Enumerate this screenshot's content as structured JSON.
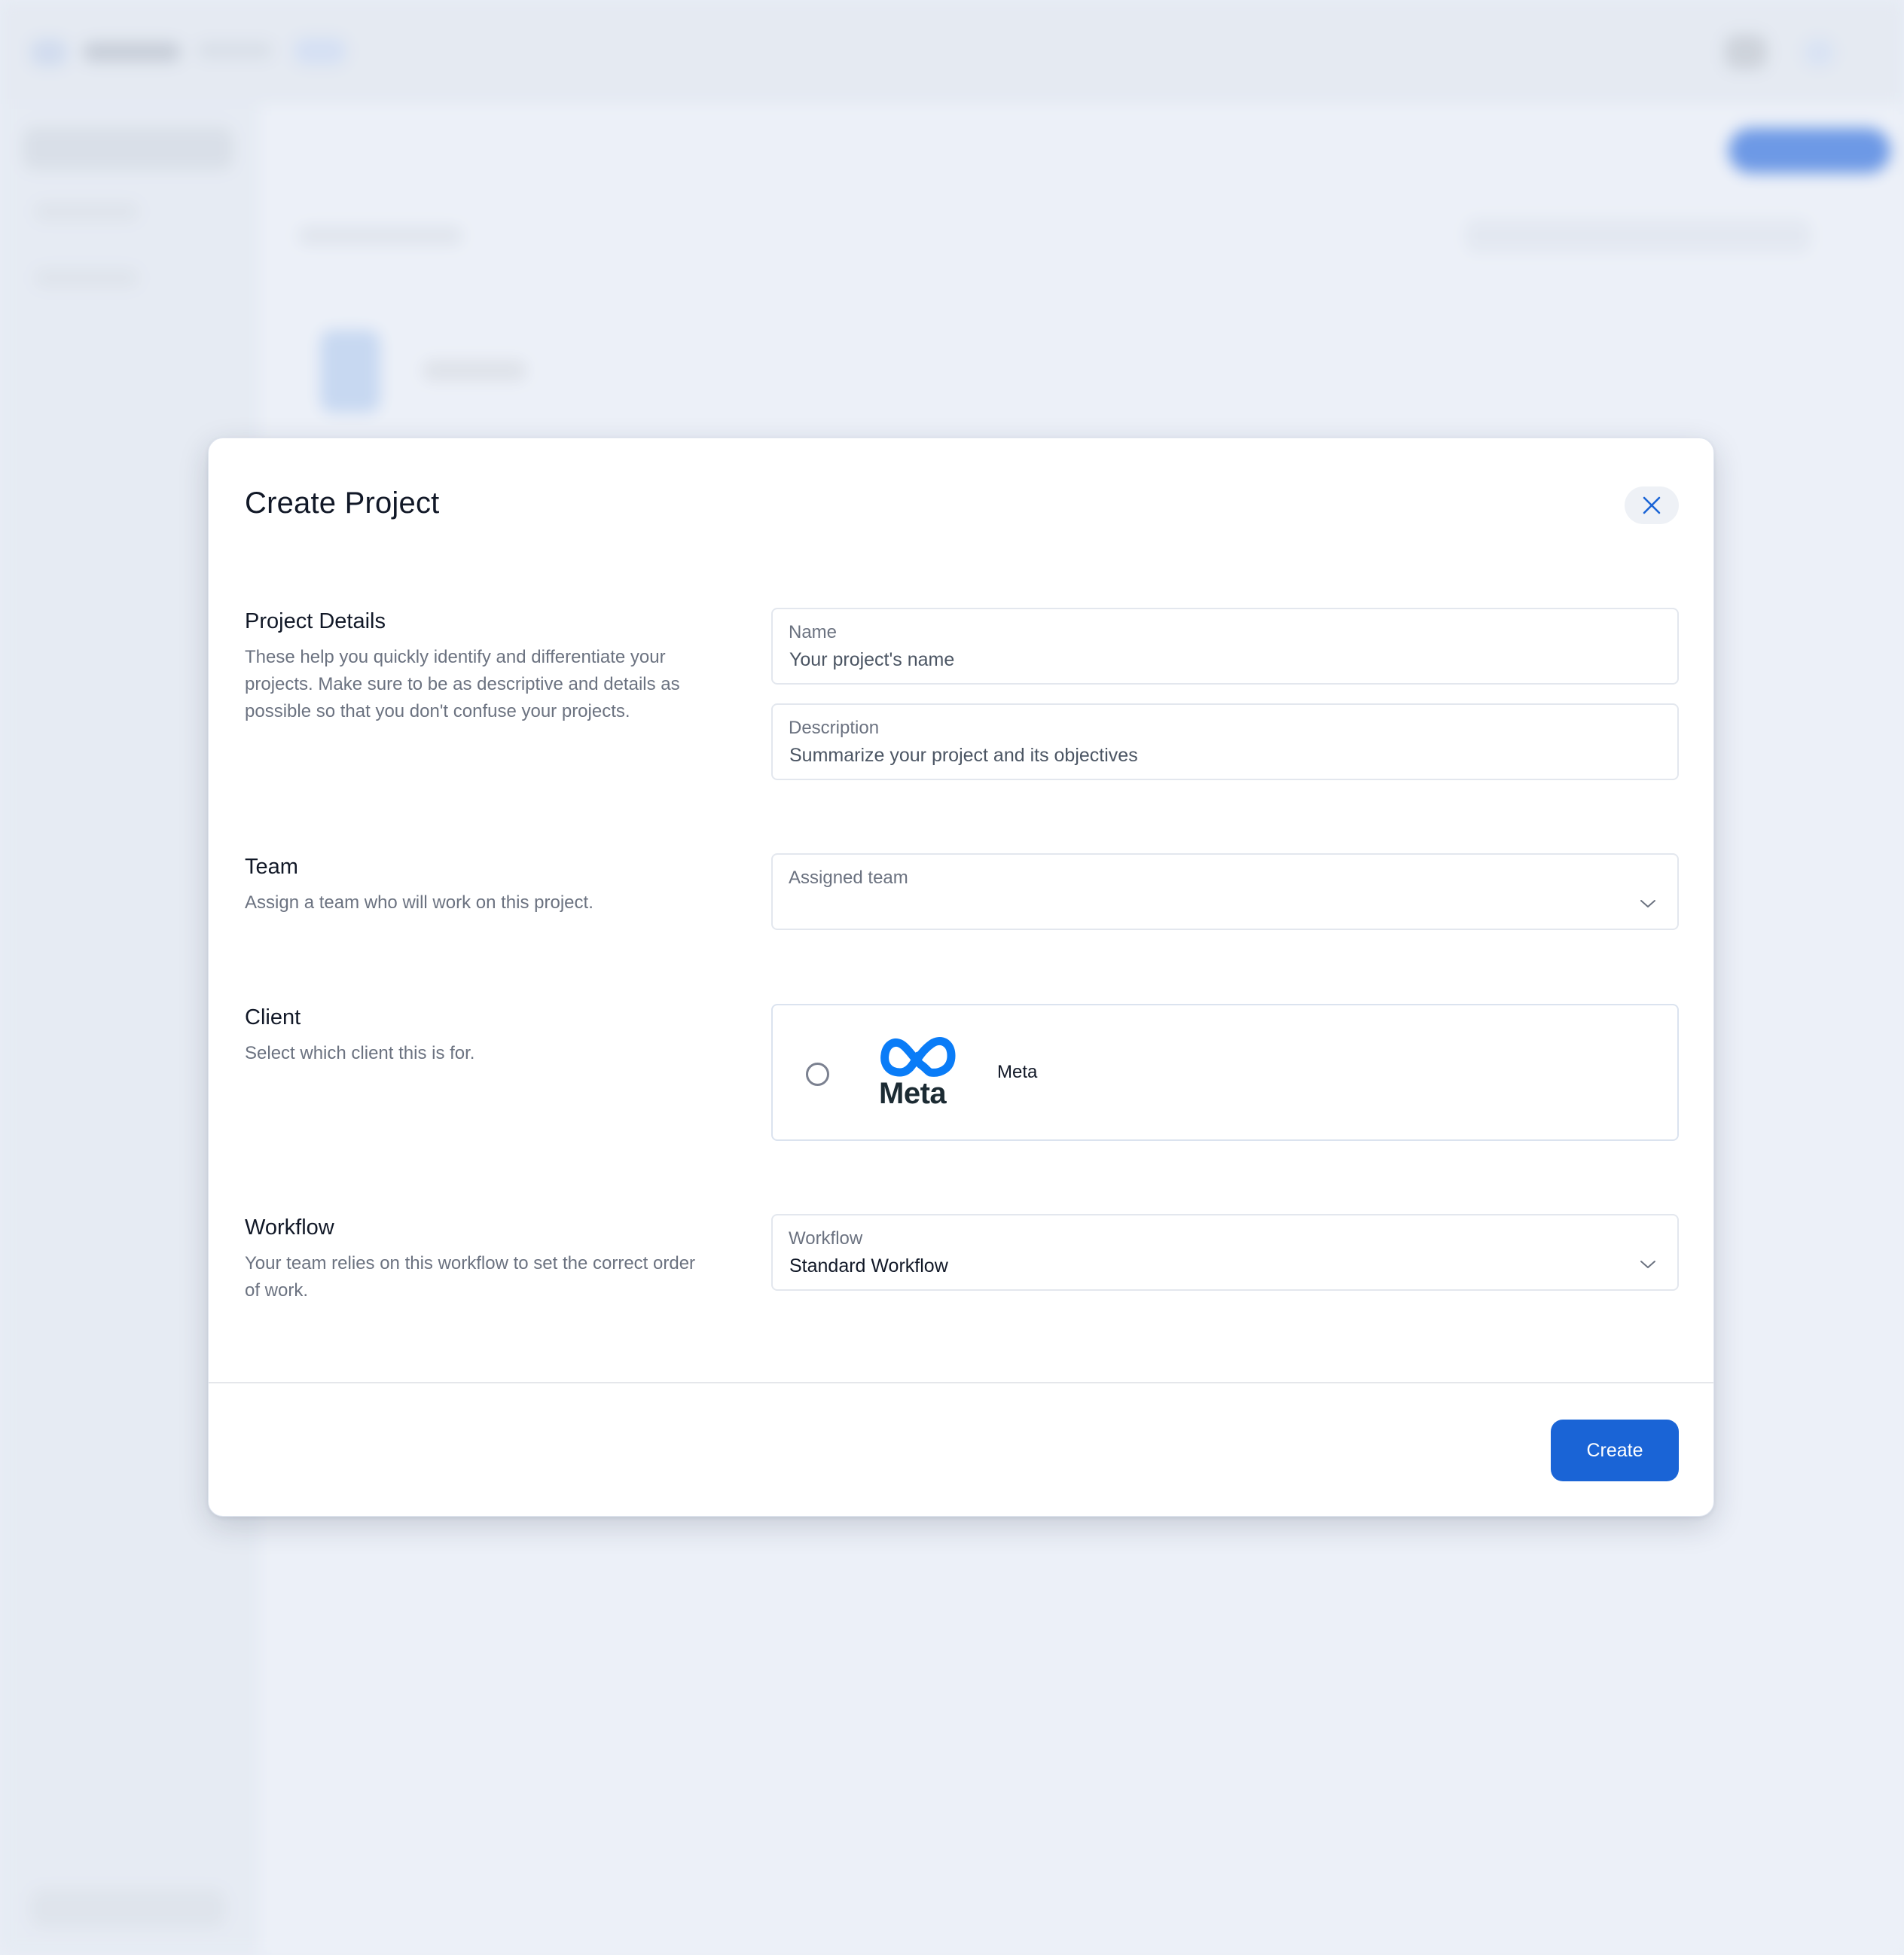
{
  "modal": {
    "title": "Create Project",
    "close_icon": "close-icon"
  },
  "sections": {
    "project_details": {
      "title": "Project Details",
      "description": "These help you quickly identify and differentiate your projects. Make sure to be as descriptive and details as possible so that you don't confuse your projects."
    },
    "team": {
      "title": "Team",
      "description": "Assign a team who will work on this project."
    },
    "client": {
      "title": "Client",
      "description": "Select which client this is for."
    },
    "workflow": {
      "title": "Workflow",
      "description": "Your team relies on this workflow to set the correct order of work."
    }
  },
  "fields": {
    "name": {
      "label": "Name",
      "placeholder": "Your project's name"
    },
    "description": {
      "label": "Description",
      "placeholder": "Summarize your project and its objectives"
    },
    "assigned_team": {
      "label": "Assigned team",
      "value": ""
    },
    "workflow": {
      "label": "Workflow",
      "value": "Standard Workflow"
    }
  },
  "client_option": {
    "name": "Meta",
    "logo_text": "Meta",
    "logo_icon": "meta-logo-icon",
    "selected": false
  },
  "footer": {
    "create_label": "Create"
  },
  "colors": {
    "primary": "#1a64d6",
    "meta_blue": "#0a7cf7",
    "meta_text": "#1c2b33"
  }
}
